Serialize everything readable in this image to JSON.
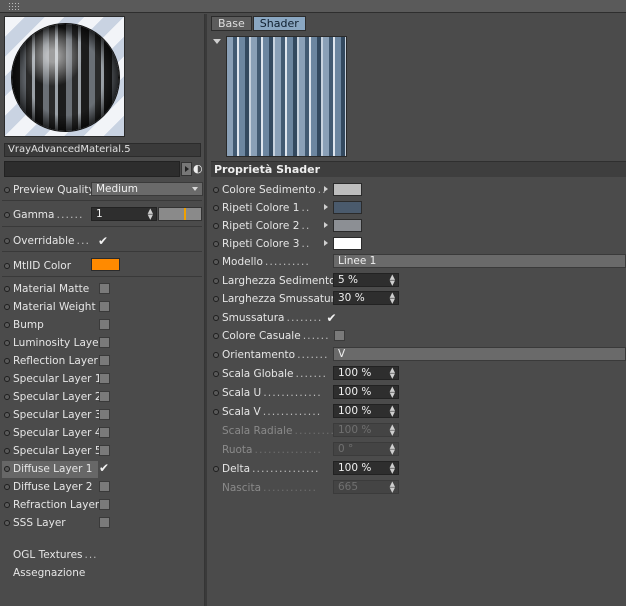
{
  "material": {
    "name": "VrayAdvancedMaterial.5",
    "preview_quality": {
      "label": "Preview Quality",
      "value": "Medium"
    },
    "gamma": {
      "label": "Gamma",
      "value": "1"
    },
    "overridable": {
      "label": "Overridable",
      "checked": true
    },
    "mtlid": {
      "label": "MtlID Color",
      "color": "#ff8a00"
    },
    "layers": [
      {
        "label": "Material Matte",
        "checked": false
      },
      {
        "label": "Material Weight",
        "checked": false
      },
      {
        "label": "Bump",
        "checked": false
      },
      {
        "label": "Luminosity Layer",
        "checked": false
      },
      {
        "label": "Reflection Layer",
        "checked": false
      },
      {
        "label": "Specular Layer 1",
        "checked": false
      },
      {
        "label": "Specular Layer 2",
        "checked": false
      },
      {
        "label": "Specular Layer 3",
        "checked": false
      },
      {
        "label": "Specular Layer 4",
        "checked": false
      },
      {
        "label": "Specular Layer 5",
        "checked": false
      },
      {
        "label": "Diffuse Layer 1",
        "checked": true
      },
      {
        "label": "Diffuse Layer 2",
        "checked": false
      },
      {
        "label": "Refraction Layer",
        "checked": false
      },
      {
        "label": "SSS Layer",
        "checked": false
      }
    ],
    "ogl_textures": "OGL Textures",
    "assegnazione": "Assegnazione"
  },
  "shader": {
    "tabs": [
      "Base",
      "Shader"
    ],
    "active_tab": "Shader",
    "section_title": "Proprietà Shader",
    "colors": [
      {
        "label": "Colore Sedimento",
        "color": "#bdbdbd"
      },
      {
        "label": "Ripeti Colore 1",
        "color": "#4a5a6c"
      },
      {
        "label": "Ripeti Colore 2",
        "color": "#8c8f94"
      },
      {
        "label": "Ripeti Colore 3",
        "color": "#ffffff"
      }
    ],
    "modello": {
      "label": "Modello",
      "value": "Linee 1"
    },
    "larghezza_sedimento": {
      "label": "Larghezza Sedimento",
      "value": "5 %"
    },
    "larghezza_smussatura": {
      "label": "Larghezza Smussatura",
      "value": "30 %"
    },
    "smussatura": {
      "label": "Smussatura",
      "checked": true
    },
    "colore_casuale": {
      "label": "Colore Casuale",
      "checked": false
    },
    "orientamento": {
      "label": "Orientamento",
      "value": "V"
    },
    "scala_globale": {
      "label": "Scala Globale",
      "value": "100 %"
    },
    "scala_u": {
      "label": "Scala U",
      "value": "100 %"
    },
    "scala_v": {
      "label": "Scala V",
      "value": "100 %"
    },
    "scala_radiale": {
      "label": "Scala Radiale",
      "value": "100 %"
    },
    "ruota": {
      "label": "Ruota",
      "value": "0 °"
    },
    "delta": {
      "label": "Delta",
      "value": "100 %"
    },
    "nascita": {
      "label": "Nascita",
      "value": "665"
    }
  }
}
